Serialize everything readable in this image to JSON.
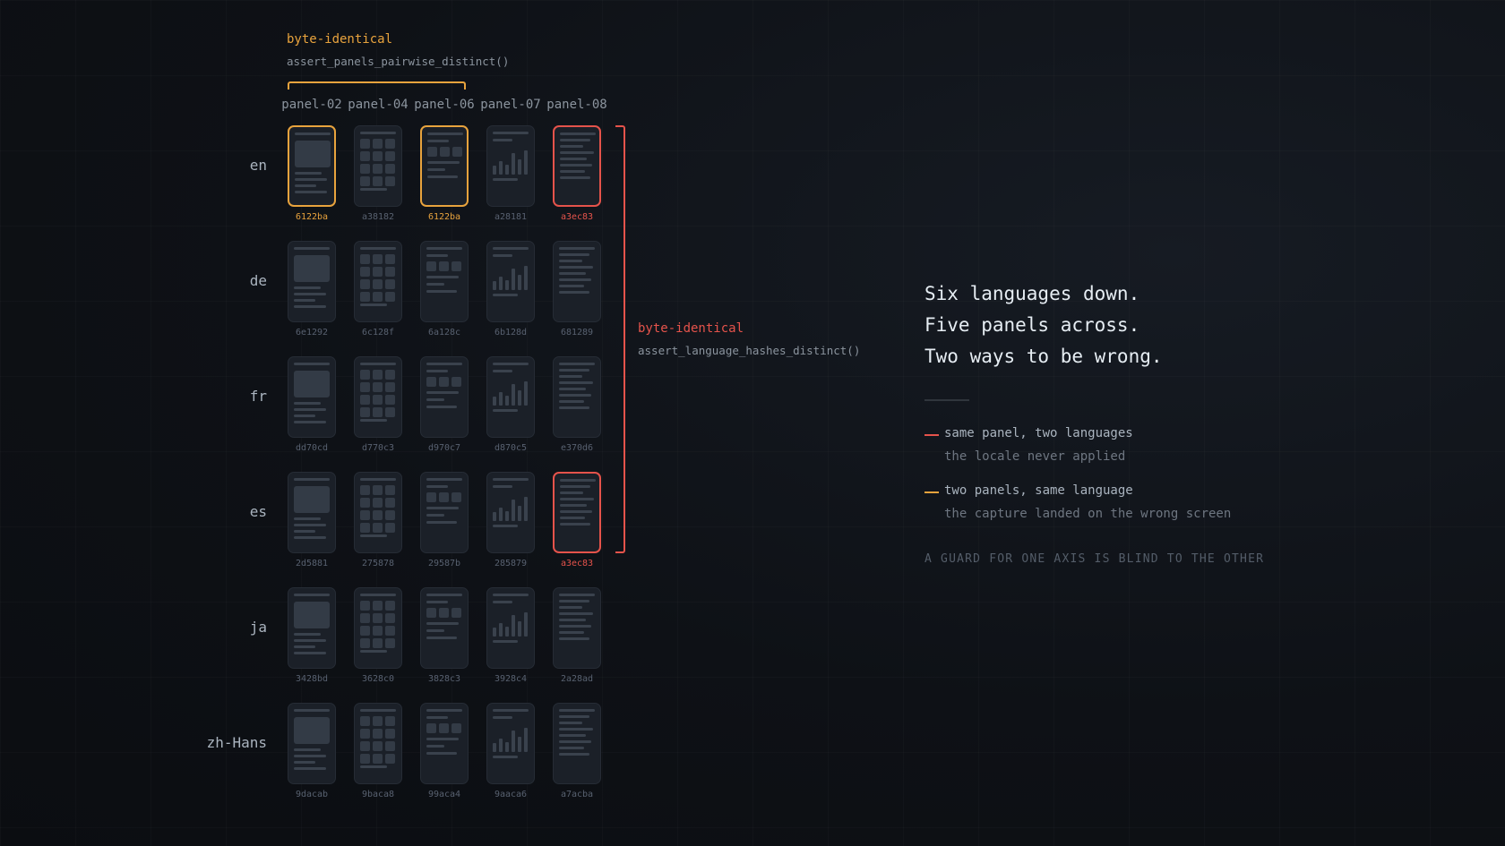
{
  "top_annotation": {
    "title": "byte-identical",
    "subtitle": "assert_panels_pairwise_distinct()"
  },
  "side_annotation": {
    "title": "byte-identical",
    "subtitle": "assert_language_hashes_distinct()"
  },
  "columns": [
    "panel-02",
    "panel-04",
    "panel-06",
    "panel-07",
    "panel-08"
  ],
  "panel_layouts": [
    "hero-block",
    "tile-grid",
    "mixed-tiles",
    "bar-chart",
    "text-list"
  ],
  "rows": [
    {
      "lang": "en",
      "hashes": [
        "6122ba",
        "a38182",
        "6122ba",
        "a28181",
        "a3ec83"
      ],
      "highlights": [
        "amber",
        "",
        "amber",
        "",
        "red"
      ]
    },
    {
      "lang": "de",
      "hashes": [
        "6e1292",
        "6c128f",
        "6a128c",
        "6b128d",
        "681289"
      ],
      "highlights": [
        "",
        "",
        "",
        "",
        ""
      ]
    },
    {
      "lang": "fr",
      "hashes": [
        "dd70cd",
        "d770c3",
        "d970c7",
        "d870c5",
        "e370d6"
      ],
      "highlights": [
        "",
        "",
        "",
        "",
        ""
      ]
    },
    {
      "lang": "es",
      "hashes": [
        "2d5881",
        "275878",
        "29587b",
        "285879",
        "a3ec83"
      ],
      "highlights": [
        "",
        "",
        "",
        "",
        "red"
      ]
    },
    {
      "lang": "ja",
      "hashes": [
        "3428bd",
        "3628c0",
        "3828c3",
        "3928c4",
        "2a28ad"
      ],
      "highlights": [
        "",
        "",
        "",
        "",
        ""
      ]
    },
    {
      "lang": "zh-Hans",
      "hashes": [
        "9dacab",
        "9baca8",
        "99aca4",
        "9aaca6",
        "a7acba"
      ],
      "highlights": [
        "",
        "",
        "",
        "",
        ""
      ]
    }
  ],
  "headline": [
    "Six languages down.",
    "Five panels across.",
    "Two ways to be wrong."
  ],
  "legend": [
    {
      "color": "#e5534b",
      "label": "same panel, two languages",
      "detail": "the locale never applied"
    },
    {
      "color": "#e8a33d",
      "label": "two panels, same language",
      "detail": "the capture landed on the wrong screen"
    }
  ],
  "footnote": "A GUARD FOR ONE AXIS IS BLIND TO THE OTHER",
  "colors": {
    "amber": "#e8a33d",
    "red": "#e5534b"
  }
}
